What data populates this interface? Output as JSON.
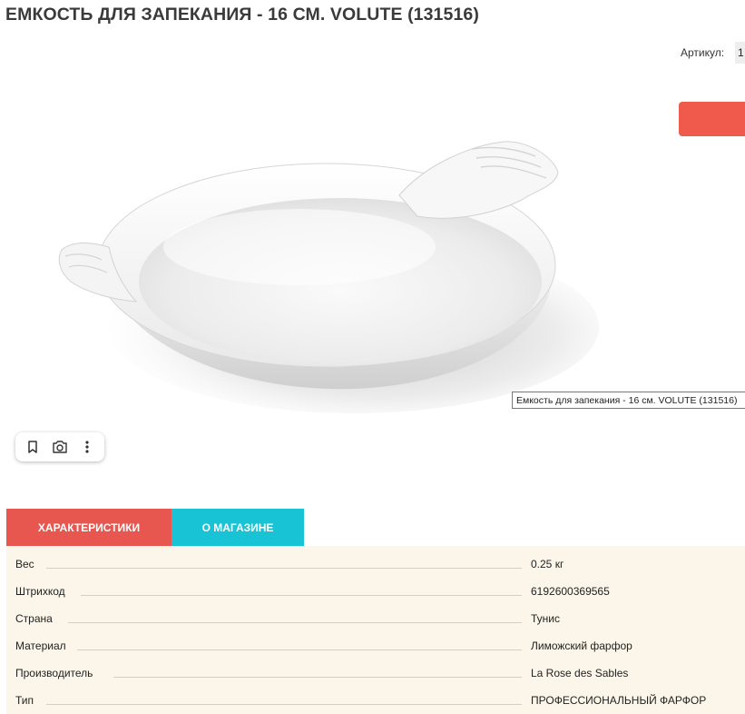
{
  "product": {
    "title": "ЕМКОСТЬ ДЛЯ ЗАПЕКАНИЯ - 16 СМ. VOLUTE (131516)",
    "sku_label": "Артикул:",
    "sku_value": "1",
    "image_caption": "Емкость для запекания - 16 см. VOLUTE (131516)"
  },
  "toolbar": {
    "icons": [
      "bookmark-icon",
      "camera-lens-icon",
      "more-vertical-icon"
    ]
  },
  "tabs": [
    {
      "label": "ХАРАКТЕРИСТИКИ",
      "active": true
    },
    {
      "label": "О МАГАЗИНЕ",
      "active": false
    }
  ],
  "specs": [
    {
      "name": "Вес",
      "value": "0.25 кг"
    },
    {
      "name": "Штрихкод",
      "value": "6192600369565"
    },
    {
      "name": "Страна",
      "value": "Тунис"
    },
    {
      "name": "Материал",
      "value": "Лиможский фарфор"
    },
    {
      "name": "Производитель",
      "value": "La Rose des Sables"
    },
    {
      "name": "Тип",
      "value": "ПРОФЕССИОНАЛЬНЫЙ ФАРФОР"
    }
  ],
  "colors": {
    "buy_button": "#ef5a4c",
    "tab_active": "#e8574f",
    "tab_inactive": "#17c3d5",
    "specs_background": "#fbf6e9"
  }
}
